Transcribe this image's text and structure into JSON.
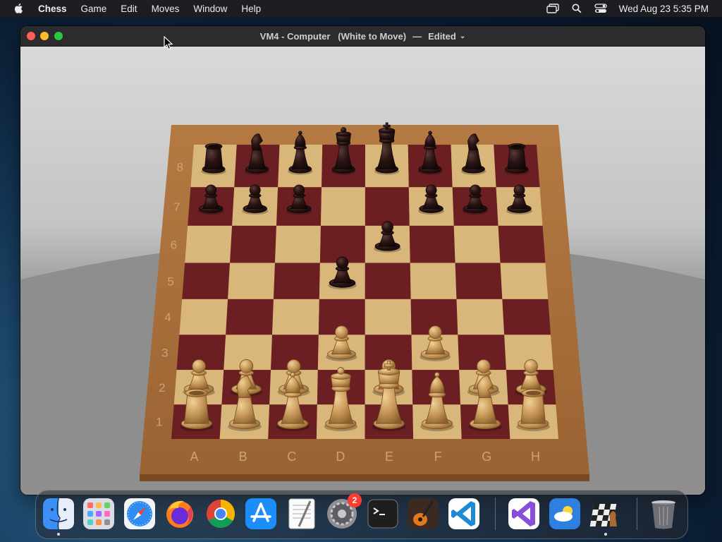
{
  "menubar": {
    "app_name": "Chess",
    "items": [
      "Game",
      "Edit",
      "Moves",
      "Window",
      "Help"
    ],
    "clock": "Wed Aug 23  5:35 PM"
  },
  "window": {
    "title_main": "VM4 - Computer   (White to Move)",
    "title_separator": "—",
    "title_status": "Edited"
  },
  "board": {
    "files": [
      "A",
      "B",
      "C",
      "D",
      "E",
      "F",
      "G",
      "H"
    ],
    "ranks": [
      "1",
      "2",
      "3",
      "4",
      "5",
      "6",
      "7",
      "8"
    ],
    "pieces": [
      {
        "color": "black",
        "type": "rook",
        "square": "a8"
      },
      {
        "color": "black",
        "type": "knight",
        "square": "b8"
      },
      {
        "color": "black",
        "type": "bishop",
        "square": "c8"
      },
      {
        "color": "black",
        "type": "queen",
        "square": "d8"
      },
      {
        "color": "black",
        "type": "king",
        "square": "e8"
      },
      {
        "color": "black",
        "type": "bishop",
        "square": "f8"
      },
      {
        "color": "black",
        "type": "knight",
        "square": "g8"
      },
      {
        "color": "black",
        "type": "rook",
        "square": "h8"
      },
      {
        "color": "black",
        "type": "pawn",
        "square": "a7"
      },
      {
        "color": "black",
        "type": "pawn",
        "square": "b7"
      },
      {
        "color": "black",
        "type": "pawn",
        "square": "c7"
      },
      {
        "color": "black",
        "type": "pawn",
        "square": "f7"
      },
      {
        "color": "black",
        "type": "pawn",
        "square": "g7"
      },
      {
        "color": "black",
        "type": "pawn",
        "square": "h7"
      },
      {
        "color": "black",
        "type": "pawn",
        "square": "e6"
      },
      {
        "color": "black",
        "type": "pawn",
        "square": "d5"
      },
      {
        "color": "white",
        "type": "pawn",
        "square": "d3"
      },
      {
        "color": "white",
        "type": "pawn",
        "square": "f3"
      },
      {
        "color": "white",
        "type": "pawn",
        "square": "a2"
      },
      {
        "color": "white",
        "type": "pawn",
        "square": "b2"
      },
      {
        "color": "white",
        "type": "pawn",
        "square": "c2"
      },
      {
        "color": "white",
        "type": "pawn",
        "square": "e2"
      },
      {
        "color": "white",
        "type": "pawn",
        "square": "g2"
      },
      {
        "color": "white",
        "type": "pawn",
        "square": "h2"
      },
      {
        "color": "white",
        "type": "rook",
        "square": "a1"
      },
      {
        "color": "white",
        "type": "knight",
        "square": "b1"
      },
      {
        "color": "white",
        "type": "bishop",
        "square": "c1"
      },
      {
        "color": "white",
        "type": "queen",
        "square": "d1"
      },
      {
        "color": "white",
        "type": "king",
        "square": "e1"
      },
      {
        "color": "white",
        "type": "bishop",
        "square": "f1"
      },
      {
        "color": "white",
        "type": "knight",
        "square": "g1"
      },
      {
        "color": "white",
        "type": "rook",
        "square": "h1"
      }
    ]
  },
  "dock": {
    "apps": [
      {
        "name": "finder",
        "running": true
      },
      {
        "name": "launchpad",
        "running": false
      },
      {
        "name": "safari",
        "running": false
      },
      {
        "name": "firefox",
        "running": false
      },
      {
        "name": "chrome",
        "running": false
      },
      {
        "name": "app-store",
        "running": false
      },
      {
        "name": "textedit",
        "running": false
      },
      {
        "name": "system-preferences",
        "running": false,
        "badge": "2"
      },
      {
        "name": "terminal",
        "running": false
      },
      {
        "name": "garageband",
        "running": false
      },
      {
        "name": "vscode",
        "running": false
      },
      {
        "name": "visual-studio",
        "running": false
      },
      {
        "name": "weather",
        "running": false
      },
      {
        "name": "chess",
        "running": true
      },
      {
        "name": "trash",
        "running": false
      }
    ]
  },
  "colors": {
    "light_square": "#d9b679",
    "dark_square": "#6b1f22",
    "board_frame": "#a8703f",
    "black_piece": "#2a1414",
    "white_piece": "#c89a5a"
  }
}
